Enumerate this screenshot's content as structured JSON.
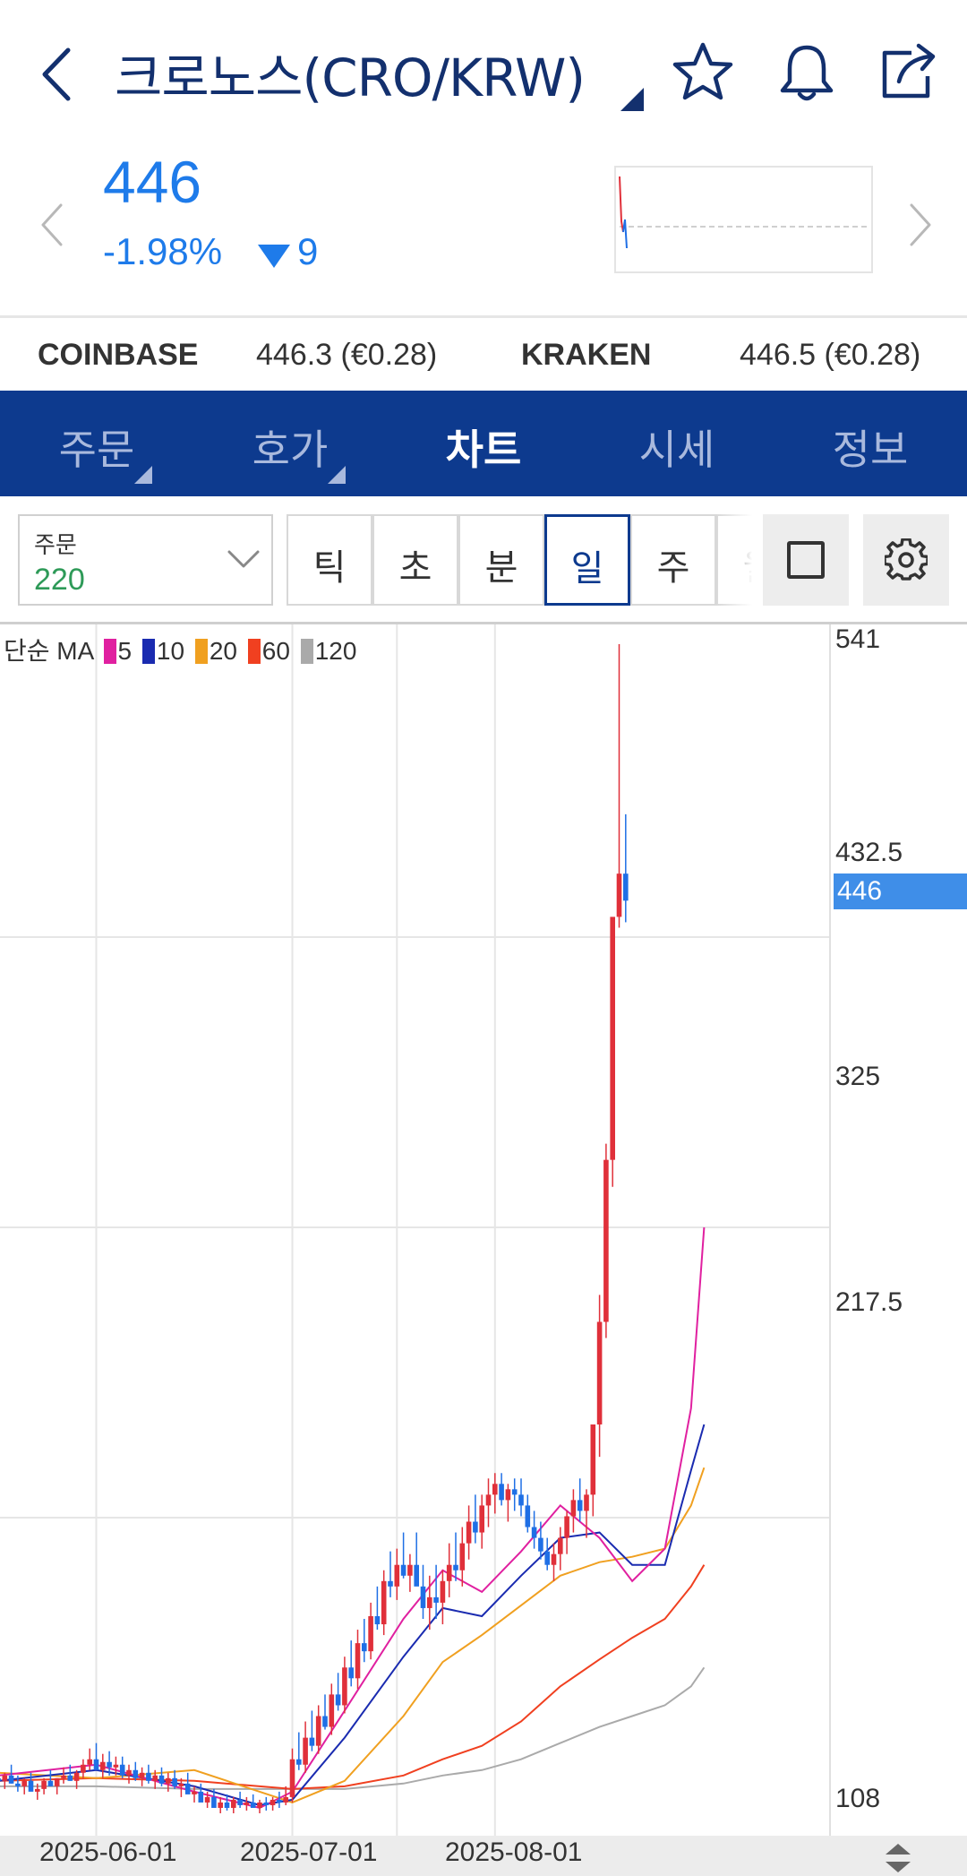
{
  "header": {
    "title": "크로노스(CRO/KRW)",
    "back_icon": "chevron-left-icon",
    "icons": [
      "star-icon",
      "bell-icon",
      "share-icon"
    ],
    "title_color": "#13306e"
  },
  "price": {
    "last": "446",
    "change_pct": "-1.98%",
    "change_abs": "9",
    "direction": "down",
    "color": "#1e7bea"
  },
  "exchanges": [
    {
      "name": "COINBASE",
      "value": "446.3 (€0.28)"
    },
    {
      "name": "KRAKEN",
      "value": "446.5 (€0.28)"
    }
  ],
  "tabs": [
    {
      "label": "주문",
      "active": false,
      "has_menu": true
    },
    {
      "label": "호가",
      "active": false,
      "has_menu": true
    },
    {
      "label": "차트",
      "active": true,
      "has_menu": false
    },
    {
      "label": "시세",
      "active": false,
      "has_menu": false
    },
    {
      "label": "정보",
      "active": false,
      "has_menu": false
    }
  ],
  "tabbar_color": "#0d3a8e",
  "controls": {
    "order_label": "주문",
    "order_value": "220",
    "periods": [
      "틱",
      "초",
      "분",
      "일",
      "주",
      "월"
    ],
    "active_period": "일"
  },
  "legend": {
    "label": "단순 MA",
    "items": [
      {
        "period": "5",
        "color": "#e020a0"
      },
      {
        "period": "10",
        "color": "#1a2bb0"
      },
      {
        "period": "20",
        "color": "#f0a020"
      },
      {
        "period": "60",
        "color": "#f04020"
      },
      {
        "period": "120",
        "color": "#aaaaaa"
      }
    ]
  },
  "chart_data": {
    "type": "candlestick",
    "current_price": 446,
    "current_price_label": "446",
    "y_ticks": [
      {
        "value": 541,
        "label": "541"
      },
      {
        "value": 432.5,
        "label": "432.5"
      },
      {
        "value": 325,
        "label": "325"
      },
      {
        "value": 217.5,
        "label": "217.5"
      },
      {
        "value": 108,
        "label": "108"
      }
    ],
    "ylim": [
      108,
      541
    ],
    "x_ticks": [
      "2025-06-01",
      "2025-07-01",
      "2025-08-01"
    ],
    "x_tick_index": [
      15,
      45,
      76
    ],
    "total_candles": 108,
    "up_color": "#e0303a",
    "down_color": "#1f6fe5",
    "ma_5": [
      [
        0,
        122
      ],
      [
        15,
        126
      ],
      [
        30,
        116
      ],
      [
        40,
        110
      ],
      [
        45,
        116
      ],
      [
        53,
        146
      ],
      [
        62,
        180
      ],
      [
        68,
        198
      ],
      [
        74,
        190
      ],
      [
        80,
        205
      ],
      [
        86,
        222
      ],
      [
        92,
        210
      ],
      [
        97,
        194
      ],
      [
        102,
        206
      ],
      [
        106,
        258
      ],
      [
        108,
        325
      ]
    ],
    "ma_10": [
      [
        0,
        120
      ],
      [
        15,
        124
      ],
      [
        30,
        118
      ],
      [
        40,
        111
      ],
      [
        45,
        113
      ],
      [
        53,
        136
      ],
      [
        62,
        166
      ],
      [
        68,
        184
      ],
      [
        74,
        181
      ],
      [
        80,
        196
      ],
      [
        86,
        210
      ],
      [
        92,
        212
      ],
      [
        97,
        200
      ],
      [
        102,
        200
      ],
      [
        106,
        235
      ],
      [
        108,
        252
      ]
    ],
    "ma_20": [
      [
        0,
        123
      ],
      [
        15,
        121
      ],
      [
        30,
        124
      ],
      [
        40,
        116
      ],
      [
        45,
        112
      ],
      [
        53,
        120
      ],
      [
        62,
        144
      ],
      [
        68,
        164
      ],
      [
        74,
        174
      ],
      [
        80,
        185
      ],
      [
        86,
        196
      ],
      [
        92,
        201
      ],
      [
        97,
        203
      ],
      [
        102,
        206
      ],
      [
        106,
        222
      ],
      [
        108,
        236
      ]
    ],
    "ma_60": [
      [
        0,
        120
      ],
      [
        15,
        121
      ],
      [
        30,
        120
      ],
      [
        40,
        118
      ],
      [
        45,
        117
      ],
      [
        53,
        118
      ],
      [
        62,
        122
      ],
      [
        68,
        128
      ],
      [
        74,
        133
      ],
      [
        80,
        142
      ],
      [
        86,
        155
      ],
      [
        92,
        165
      ],
      [
        97,
        173
      ],
      [
        102,
        180
      ],
      [
        106,
        192
      ],
      [
        108,
        200
      ]
    ],
    "ma_120": [
      [
        0,
        118
      ],
      [
        15,
        118
      ],
      [
        30,
        117
      ],
      [
        40,
        117
      ],
      [
        45,
        117
      ],
      [
        53,
        117
      ],
      [
        62,
        119
      ],
      [
        68,
        122
      ],
      [
        74,
        124
      ],
      [
        80,
        128
      ],
      [
        86,
        134
      ],
      [
        92,
        140
      ],
      [
        97,
        144
      ],
      [
        102,
        148
      ],
      [
        106,
        155
      ],
      [
        108,
        162
      ]
    ],
    "candles": [
      [
        121,
        124,
        118,
        120
      ],
      [
        120,
        123,
        117,
        122
      ],
      [
        122,
        126,
        119,
        119
      ],
      [
        119,
        122,
        116,
        118
      ],
      [
        118,
        121,
        115,
        120
      ],
      [
        120,
        123,
        118,
        116
      ],
      [
        116,
        119,
        113,
        117
      ],
      [
        117,
        121,
        115,
        120
      ],
      [
        120,
        124,
        118,
        118
      ],
      [
        118,
        121,
        115,
        121
      ],
      [
        121,
        125,
        119,
        122
      ],
      [
        122,
        126,
        120,
        120
      ],
      [
        120,
        124,
        117,
        123
      ],
      [
        123,
        128,
        121,
        126
      ],
      [
        126,
        132,
        124,
        128
      ],
      [
        128,
        134,
        125,
        124
      ],
      [
        124,
        130,
        121,
        127
      ],
      [
        127,
        131,
        122,
        125
      ],
      [
        125,
        129,
        122,
        126
      ],
      [
        126,
        129,
        121,
        122
      ],
      [
        122,
        126,
        119,
        124
      ],
      [
        124,
        127,
        120,
        121
      ],
      [
        121,
        125,
        118,
        123
      ],
      [
        123,
        126,
        119,
        120
      ],
      [
        120,
        124,
        117,
        122
      ],
      [
        122,
        125,
        118,
        119
      ],
      [
        119,
        123,
        116,
        121
      ],
      [
        121,
        124,
        117,
        118
      ],
      [
        118,
        121,
        114,
        119
      ],
      [
        119,
        123,
        117,
        115
      ],
      [
        115,
        118,
        112,
        116
      ],
      [
        116,
        119,
        113,
        112
      ],
      [
        112,
        116,
        110,
        114
      ],
      [
        114,
        117,
        111,
        110
      ],
      [
        110,
        114,
        108,
        112
      ],
      [
        112,
        115,
        109,
        110
      ],
      [
        110,
        114,
        108,
        113
      ],
      [
        113,
        116,
        110,
        111
      ],
      [
        111,
        114,
        109,
        112
      ],
      [
        112,
        115,
        110,
        110
      ],
      [
        110,
        113,
        108,
        112
      ],
      [
        112,
        114,
        109,
        111
      ],
      [
        111,
        114,
        109,
        113
      ],
      [
        113,
        116,
        110,
        112
      ],
      [
        112,
        118,
        111,
        114
      ],
      [
        114,
        132,
        112,
        128
      ],
      [
        128,
        138,
        124,
        126
      ],
      [
        126,
        142,
        123,
        136
      ],
      [
        136,
        146,
        131,
        133
      ],
      [
        133,
        148,
        130,
        144
      ],
      [
        144,
        152,
        139,
        140
      ],
      [
        140,
        156,
        137,
        152
      ],
      [
        152,
        160,
        146,
        148
      ],
      [
        148,
        166,
        145,
        162
      ],
      [
        162,
        172,
        155,
        158
      ],
      [
        158,
        176,
        154,
        171
      ],
      [
        171,
        180,
        164,
        168
      ],
      [
        168,
        186,
        165,
        181
      ],
      [
        181,
        192,
        176,
        178
      ],
      [
        178,
        198,
        174,
        194
      ],
      [
        194,
        205,
        188,
        192
      ],
      [
        192,
        206,
        187,
        200
      ],
      [
        200,
        212,
        195,
        196
      ],
      [
        196,
        204,
        190,
        200
      ],
      [
        200,
        212,
        194,
        192
      ],
      [
        192,
        200,
        180,
        184
      ],
      [
        184,
        196,
        176,
        188
      ],
      [
        188,
        200,
        180,
        186
      ],
      [
        186,
        198,
        178,
        194
      ],
      [
        194,
        208,
        188,
        200
      ],
      [
        200,
        212,
        194,
        198
      ],
      [
        198,
        214,
        192,
        208
      ],
      [
        208,
        222,
        202,
        216
      ],
      [
        216,
        226,
        208,
        212
      ],
      [
        212,
        226,
        206,
        222
      ],
      [
        222,
        232,
        214,
        226
      ],
      [
        226,
        234,
        219,
        230
      ],
      [
        230,
        234,
        222,
        224
      ],
      [
        224,
        230,
        216,
        228
      ],
      [
        228,
        232,
        220,
        226
      ],
      [
        226,
        232,
        218,
        222
      ],
      [
        222,
        226,
        212,
        214
      ],
      [
        214,
        220,
        206,
        210
      ],
      [
        210,
        216,
        202,
        205
      ],
      [
        205,
        210,
        198,
        200
      ],
      [
        200,
        208,
        194,
        204
      ],
      [
        204,
        214,
        198,
        210
      ],
      [
        210,
        220,
        204,
        218
      ],
      [
        218,
        228,
        212,
        224
      ],
      [
        224,
        232,
        216,
        220
      ],
      [
        220,
        228,
        210,
        226
      ],
      [
        226,
        236,
        218,
        252
      ],
      [
        252,
        300,
        240,
        290
      ],
      [
        290,
        356,
        284,
        350
      ],
      [
        350,
        420,
        340,
        440
      ],
      [
        440,
        541,
        436,
        456
      ],
      [
        456,
        478,
        438,
        446
      ]
    ]
  }
}
